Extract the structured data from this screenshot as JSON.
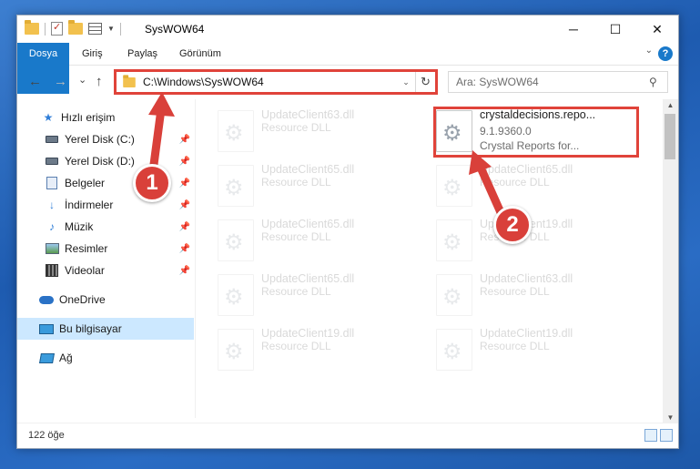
{
  "window": {
    "title": "SysWOW64",
    "controls": {
      "minimize": "─",
      "maximize": "☐",
      "close": "✕"
    }
  },
  "ribbon": {
    "tabs": [
      "Dosya",
      "Giriş",
      "Paylaş",
      "Görünüm"
    ],
    "help": "?"
  },
  "nav": {
    "back": "←",
    "forward": "→",
    "recent": "⌄",
    "up": "↑",
    "address": "C:\\Windows\\SysWOW64",
    "search_placeholder": "Ara: SysWOW64"
  },
  "sidebar": {
    "items": [
      {
        "label": "Hızlı erişim",
        "icon": "star-icon"
      },
      {
        "label": "Yerel Disk (C:)",
        "icon": "disk-icon",
        "pinned": true
      },
      {
        "label": "Yerel Disk (D:)",
        "icon": "disk-icon",
        "pinned": true
      },
      {
        "label": "Belgeler",
        "icon": "document-icon",
        "pinned": true
      },
      {
        "label": "İndirmeler",
        "icon": "download-icon",
        "pinned": true
      },
      {
        "label": "Müzik",
        "icon": "music-icon",
        "pinned": true
      },
      {
        "label": "Resimler",
        "icon": "pictures-icon",
        "pinned": true
      },
      {
        "label": "Videolar",
        "icon": "video-icon",
        "pinned": true
      },
      {
        "label": "OneDrive",
        "icon": "cloud-icon"
      },
      {
        "label": "Bu bilgisayar",
        "icon": "computer-icon",
        "selected": true
      },
      {
        "label": "Ağ",
        "icon": "network-icon"
      }
    ]
  },
  "files": [
    {
      "name": "UpdateClient63.dll",
      "desc": "Resource DLL",
      "faded": true
    },
    {
      "name": "crystaldecisions.repo...",
      "version": "9.1.9360.0",
      "desc": "Crystal Reports for...",
      "faded": false
    },
    {
      "name": "UpdateClient65.dll",
      "desc": "Resource DLL",
      "faded": true
    },
    {
      "name": "UpdateClient65.dll",
      "desc": "Resource DLL",
      "faded": true
    },
    {
      "name": "UpdateClient65.dll",
      "desc": "Resource DLL",
      "faded": true
    },
    {
      "name": "UpdateClient19.dll",
      "desc": "Resource DLL",
      "faded": true
    },
    {
      "name": "UpdateClient65.dll",
      "desc": "Resource DLL",
      "faded": true
    },
    {
      "name": "UpdateClient63.dll",
      "desc": "Resource DLL",
      "faded": true
    },
    {
      "name": "UpdateClient19.dll",
      "desc": "Resource DLL",
      "faded": true
    },
    {
      "name": "UpdateClient19.dll",
      "desc": "Resource DLL",
      "faded": true
    }
  ],
  "status": {
    "count": "122 öğe"
  },
  "callouts": [
    "1",
    "2"
  ],
  "colors": {
    "accent": "#1979ca",
    "highlight": "#e0433a",
    "selected": "#cce8ff"
  }
}
